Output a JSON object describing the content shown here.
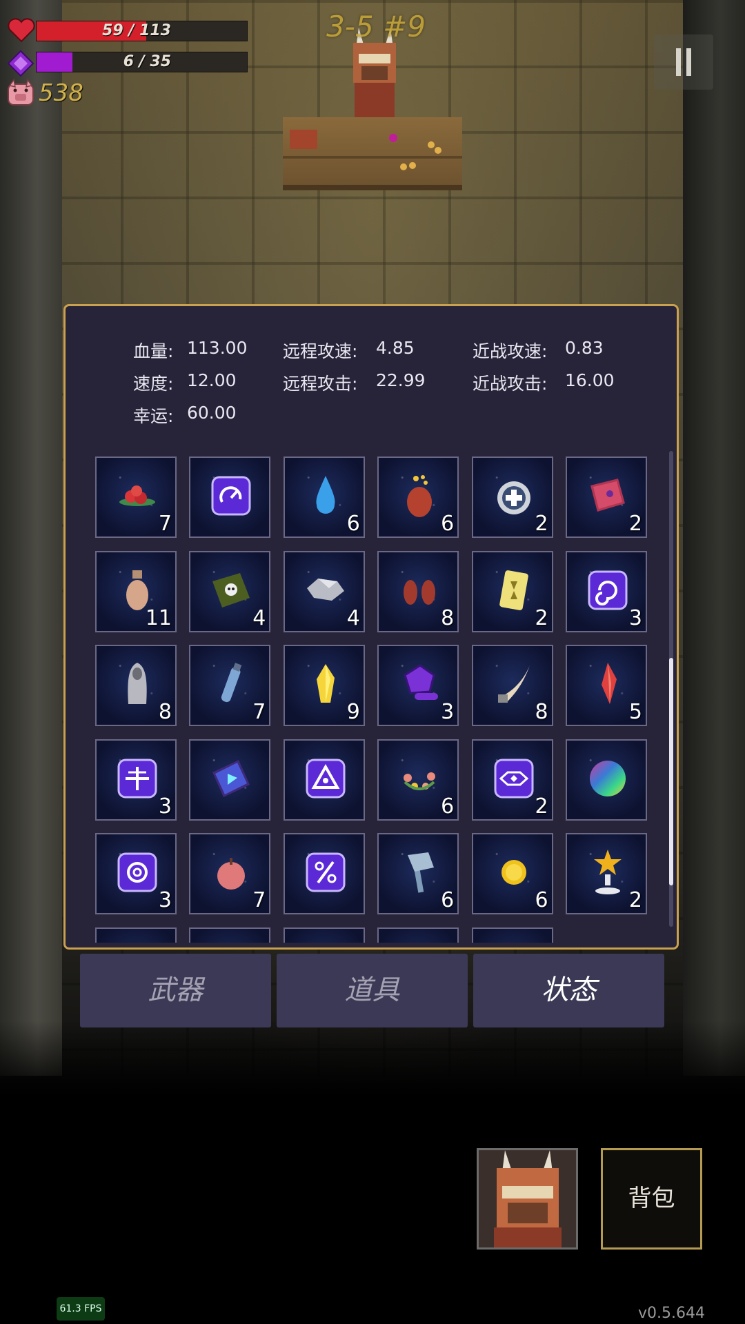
{
  "hud": {
    "hp": {
      "current": 59,
      "max": 113,
      "text": "59 / 113",
      "color": "#d4202a"
    },
    "mana": {
      "current": 6,
      "max": 35,
      "text": "6 / 35",
      "color": "#a11bd0"
    },
    "gold": "538",
    "stage": "3-5 #9",
    "icons": [
      "heart-icon",
      "mana-crystal-icon",
      "pig-coin-icon",
      "pause-icon"
    ]
  },
  "stats": {
    "hp_label": "血量:",
    "hp_value": "113.00",
    "speed_label": "速度:",
    "speed_value": "12.00",
    "luck_label": "幸运:",
    "luck_value": "60.00",
    "ranged_speed_label": "远程攻速:",
    "ranged_speed_value": "4.85",
    "ranged_attack_label": "远程攻击:",
    "ranged_attack_value": "22.99",
    "melee_speed_label": "近战攻速:",
    "melee_speed_value": "0.83",
    "melee_attack_label": "近战攻击:",
    "melee_attack_value": "16.00"
  },
  "items": [
    {
      "icon": "red-berries-icon",
      "count": "7"
    },
    {
      "icon": "purple-rune-gauge-icon",
      "count": ""
    },
    {
      "icon": "blue-drop-icon",
      "count": "6"
    },
    {
      "icon": "red-sack-coins-icon",
      "count": "6"
    },
    {
      "icon": "silver-ring-cross-icon",
      "count": "2"
    },
    {
      "icon": "red-spellbook-icon",
      "count": "2"
    },
    {
      "icon": "tan-pouch-icon",
      "count": "11"
    },
    {
      "icon": "green-skull-book-icon",
      "count": "4"
    },
    {
      "icon": "silver-ore-icon",
      "count": "4"
    },
    {
      "icon": "red-gloves-icon",
      "count": "8"
    },
    {
      "icon": "yellow-card-icon",
      "count": "2"
    },
    {
      "icon": "purple-rune-swirl-icon",
      "count": "3"
    },
    {
      "icon": "hooded-statue-icon",
      "count": "8"
    },
    {
      "icon": "blue-vial-icon",
      "count": "7"
    },
    {
      "icon": "yellow-crystal-icon",
      "count": "9"
    },
    {
      "icon": "purple-snail-shell-icon",
      "count": "3"
    },
    {
      "icon": "horn-icon",
      "count": "8"
    },
    {
      "icon": "red-crystal-icon",
      "count": "5"
    },
    {
      "icon": "purple-rune-cross-icon",
      "count": "3"
    },
    {
      "icon": "blue-arrow-book-icon",
      "count": ""
    },
    {
      "icon": "purple-rune-triangle-icon",
      "count": ""
    },
    {
      "icon": "flower-wreath-icon",
      "count": "6"
    },
    {
      "icon": "purple-rune-eye-icon",
      "count": "2"
    },
    {
      "icon": "rainbow-orb-icon",
      "count": ""
    },
    {
      "icon": "purple-rune-spiral-icon",
      "count": "3"
    },
    {
      "icon": "red-apple-icon",
      "count": "7"
    },
    {
      "icon": "purple-rune-percent-icon",
      "count": ""
    },
    {
      "icon": "stone-axe-icon",
      "count": "6"
    },
    {
      "icon": "gold-coin-icon",
      "count": "6"
    },
    {
      "icon": "star-trophy-icon",
      "count": "2"
    },
    {
      "icon": "item-icon",
      "count": ""
    },
    {
      "icon": "item-icon",
      "count": ""
    },
    {
      "icon": "item-icon",
      "count": ""
    },
    {
      "icon": "item-icon",
      "count": ""
    },
    {
      "icon": "item-icon",
      "count": ""
    }
  ],
  "tabs": [
    {
      "label": "武器",
      "active": false
    },
    {
      "label": "道具",
      "active": false
    },
    {
      "label": "状态",
      "active": true
    }
  ],
  "bag_label": "背包",
  "fps": "61.3 FPS",
  "version": "v0.5.644"
}
